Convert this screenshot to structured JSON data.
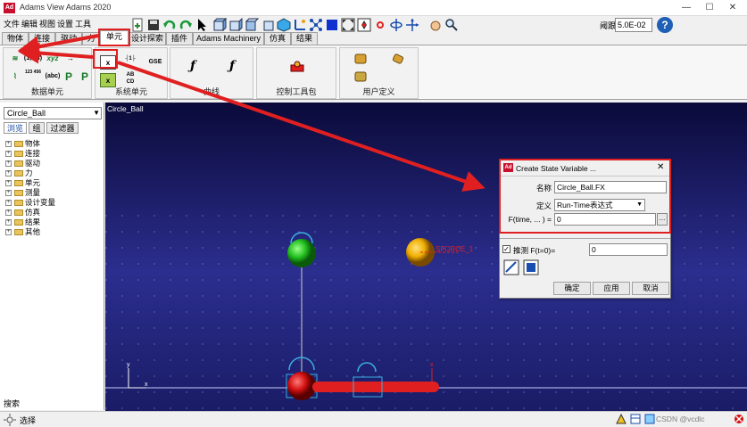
{
  "window": {
    "app_icon_text": "Ad",
    "title": "Adams View Adams 2020",
    "minimize": "—",
    "maximize": "☐",
    "close": "✕"
  },
  "menu": [
    "文件",
    "编辑",
    "视图",
    "设置",
    "工具"
  ],
  "toolbar": {
    "zoom_label": "阈跟",
    "zoom_value": "5.0E-02",
    "help": "?"
  },
  "tabs": [
    "物体",
    "连接",
    "驱动",
    "力",
    "单元",
    "设计探索",
    "插件",
    "Adams Machinery",
    "仿真",
    "结果"
  ],
  "active_tab": "单元",
  "ribbon": {
    "groups": [
      {
        "label": "数据单元",
        "icons": [
          "(1,2,3)",
          "xyz",
          "→",
          "123 456",
          "(abc)",
          "P",
          "P"
        ]
      },
      {
        "label": "系统单元",
        "icons": [
          "x",
          "GSE",
          "x",
          "AB CD"
        ]
      },
      {
        "label": "曲线",
        "icons": [
          "ƒ",
          "ƒ"
        ]
      },
      {
        "label": "控制工具包",
        "icons": []
      },
      {
        "label": "用户定义",
        "icons": []
      }
    ]
  },
  "left_panel": {
    "model": "Circle_Ball",
    "tabs": [
      "浏览",
      "组",
      "过滤器"
    ],
    "tree": [
      "物体",
      "连接",
      "驱动",
      "力",
      "单元",
      "测量",
      "设计变量",
      "仿真",
      "结果",
      "其他"
    ],
    "search_label": "搜索"
  },
  "viewport": {
    "title": "Circle_Ball",
    "force_label": "SFORCE_1"
  },
  "dialog": {
    "icon_text": "Ad",
    "title": "Create State Variable ...",
    "close": "✕",
    "name_label": "名称",
    "name_value": "Circle_Ball.FX",
    "define_label": "定义",
    "define_value": "Run-Time表达式",
    "f_label": "F(time, ... ) =",
    "f_value": "0",
    "ellipsis": "...",
    "guess_label": "推测 F(t=0)=",
    "guess_value": "0",
    "ok": "确定",
    "apply": "应用",
    "cancel": "取消"
  },
  "status": {
    "text": "选择",
    "watermark": "CSDN @vcdlc"
  },
  "colors": {
    "annotation_red": "#e02020",
    "viewport_top": "#0b0a3a",
    "viewport_bottom": "#2b2e8e",
    "ball_green": "#22c020",
    "ball_yellow": "#f0b000",
    "ball_red": "#d01010"
  }
}
